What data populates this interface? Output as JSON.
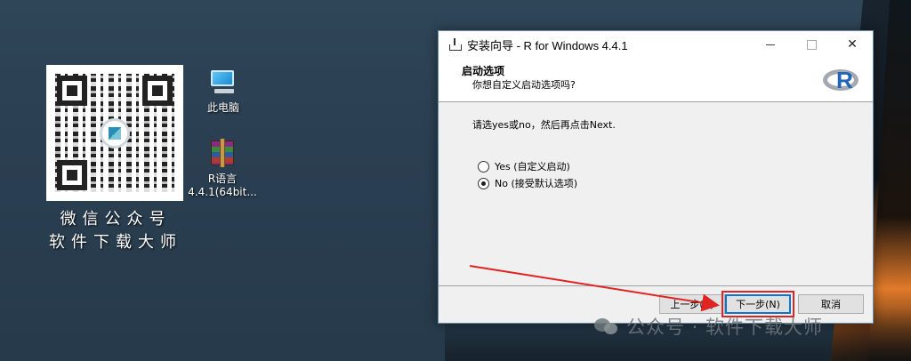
{
  "qr_caption": {
    "line1": "微信公众号",
    "line2": "软件下载大师"
  },
  "desktop_icons": [
    {
      "label": "此电脑",
      "icon": "computer-icon"
    },
    {
      "label": "R语言\n4.4.1(64bit...",
      "line1": "R语言",
      "line2": "4.4.1(64bit...",
      "icon": "winrar-archive-icon"
    }
  ],
  "window": {
    "title": "安装向导 - R for Windows 4.4.1",
    "close_glyph": "✕",
    "header": {
      "title": "启动选项",
      "subtitle": "你想自定义启动选项吗?"
    },
    "prompt": "请选yes或no，然后再点击Next.",
    "options": [
      {
        "label": "Yes (自定义启动)",
        "checked": false
      },
      {
        "label": "No (接受默认选项)",
        "checked": true
      }
    ],
    "buttons": {
      "back": "上一步(B)",
      "next": "下一步(N)",
      "cancel": "取消"
    }
  },
  "watermark": "公众号 · 软件下载大师",
  "colors": {
    "desktop_bg": "#2c4355",
    "highlight_red": "#e02424",
    "r_blue": "#2165b6"
  }
}
